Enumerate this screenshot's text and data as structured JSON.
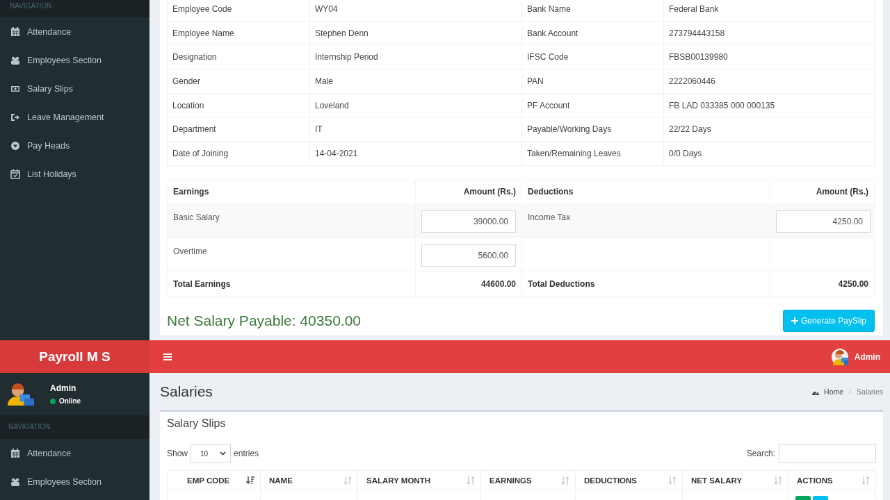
{
  "top_screen": {
    "sidebar": {
      "heading": "NAVIGATION",
      "items": [
        {
          "label": "Attendance"
        },
        {
          "label": "Employees Section"
        },
        {
          "label": "Salary Slips"
        },
        {
          "label": "Leave Management"
        },
        {
          "label": "Pay Heads"
        },
        {
          "label": "List Holidays"
        }
      ]
    },
    "employee_details": [
      {
        "label": "Employee Code",
        "value": "WY04",
        "label_2": "Bank Name",
        "value_2": "Federal Bank"
      },
      {
        "label": "Employee Name",
        "value": "Stephen Denn",
        "label_2": "Bank Account",
        "value_2": "273794443158"
      },
      {
        "label": "Designation",
        "value": "Internship Period",
        "label_2": "IFSC Code",
        "value_2": "FBSB00139980"
      },
      {
        "label": "Gender",
        "value": "Male",
        "label_2": "PAN",
        "value_2": "2222060446"
      },
      {
        "label": "Location",
        "value": "Loveland",
        "label_2": "PF Account",
        "value_2": "FB LAD 033385 000 000135"
      },
      {
        "label": "Department",
        "value": "IT",
        "label_2": "Payable/Working Days",
        "value_2": "22/22 Days"
      },
      {
        "label": "Date of Joining",
        "value": "14-04-2021",
        "label_2": "Taken/Remaining Leaves",
        "value_2": "0/0 Days"
      }
    ],
    "pay_table": {
      "columns": [
        "Earnings",
        "Amount (Rs.)",
        "Deductions",
        "Amount (Rs.)"
      ],
      "rows": [
        {
          "earning": "Basic Salary",
          "earning_amount": "39000.00",
          "deduction": "Income Tax",
          "deduction_amount": "4250.00"
        },
        {
          "earning": "Overtime",
          "earning_amount": "5600.00"
        }
      ],
      "totals": {
        "earnings_label": "Total Earnings",
        "earnings": "44600.00",
        "deductions_label": "Total Deductions",
        "deductions": "4250.00"
      }
    },
    "net_salary": "Net Salary Payable: 40350.00",
    "generate_button": "Generate PaySlip"
  },
  "bottom_screen": {
    "header": {
      "logo": "Payroll M S",
      "user": "Admin"
    },
    "sidebar": {
      "user_name": "Admin",
      "status": "Online",
      "heading": "NAVIGATION",
      "items": [
        {
          "label": "Attendance"
        },
        {
          "label": "Employees Section"
        }
      ]
    },
    "page_title": "Salaries",
    "breadcrumb": [
      "Home",
      "Salaries"
    ],
    "box_title": "Salary Slips",
    "length_menu": {
      "before": "Show",
      "value": "10",
      "after": "entries"
    },
    "search": {
      "label": "Search:"
    },
    "table": {
      "columns": [
        {
          "label": "EMP CODE",
          "sorted": true
        },
        {
          "label": "NAME",
          "sorted": false
        },
        {
          "label": "SALARY MONTH",
          "sorted": false
        },
        {
          "label": "EARNINGS",
          "sorted": false
        },
        {
          "label": "DEDUCTIONS",
          "sorted": false
        },
        {
          "label": "NET SALARY",
          "sorted": false
        },
        {
          "label": "ACTIONS",
          "sorted": false
        }
      ]
    }
  }
}
